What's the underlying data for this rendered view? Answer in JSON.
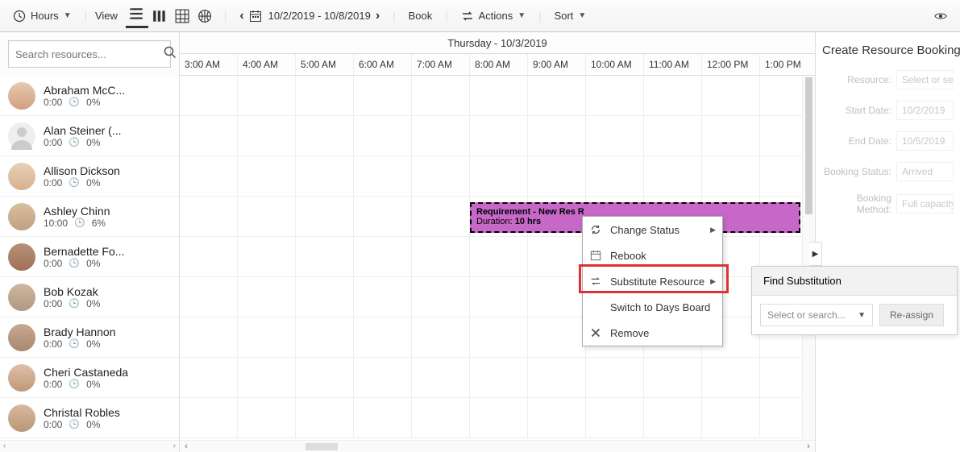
{
  "toolbar": {
    "hours_label": "Hours",
    "view_label": "View",
    "date_range": "10/2/2019 - 10/8/2019",
    "book_label": "Book",
    "actions_label": "Actions",
    "sort_label": "Sort"
  },
  "search": {
    "placeholder": "Search resources..."
  },
  "date_header": "Thursday - 10/3/2019",
  "time_cols": [
    "3:00 AM",
    "4:00 AM",
    "5:00 AM",
    "6:00 AM",
    "7:00 AM",
    "8:00 AM",
    "9:00 AM",
    "10:00 AM",
    "11:00 AM",
    "12:00 PM",
    "1:00 PM"
  ],
  "resources": [
    {
      "name": "Abraham McC...",
      "hours": "0:00",
      "pct": "0%"
    },
    {
      "name": "Alan Steiner (...",
      "hours": "0:00",
      "pct": "0%"
    },
    {
      "name": "Allison Dickson",
      "hours": "0:00",
      "pct": "0%"
    },
    {
      "name": "Ashley Chinn",
      "hours": "10:00",
      "pct": "6%"
    },
    {
      "name": "Bernadette Fo...",
      "hours": "0:00",
      "pct": "0%"
    },
    {
      "name": "Bob Kozak",
      "hours": "0:00",
      "pct": "0%"
    },
    {
      "name": "Brady Hannon",
      "hours": "0:00",
      "pct": "0%"
    },
    {
      "name": "Cheri Castaneda",
      "hours": "0:00",
      "pct": "0%"
    },
    {
      "name": "Christal Robles",
      "hours": "0:00",
      "pct": "0%"
    }
  ],
  "booking": {
    "line1_label": "Requirement - ",
    "line1_value": "New Res R",
    "line2_label": "Duration: ",
    "line2_value": "10 hrs"
  },
  "context_menu": {
    "change_status": "Change Status",
    "rebook": "Rebook",
    "substitute": "Substitute Resource",
    "switch_board": "Switch to Days Board",
    "remove": "Remove"
  },
  "flyout": {
    "tab": "Find Substitution",
    "select_placeholder": "Select or search...",
    "button": "Re-assign"
  },
  "right_panel": {
    "title": "Create Resource Booking",
    "fields": {
      "resource_label": "Resource:",
      "resource_val": "Select or sear",
      "start_label": "Start Date:",
      "start_val": "10/2/2019",
      "end_label": "End Date:",
      "end_val": "10/5/2019",
      "status_label": "Booking Status:",
      "status_val": "Arrived",
      "method_label": "Booking Method:",
      "method_val": "Full capacity"
    }
  }
}
